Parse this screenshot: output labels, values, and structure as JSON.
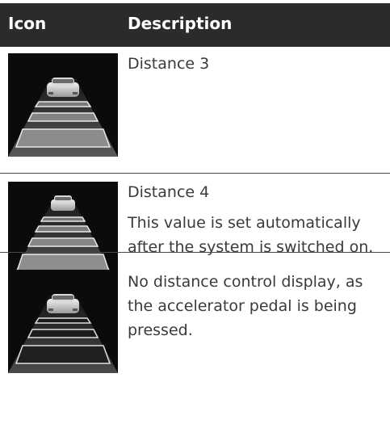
{
  "table": {
    "header": {
      "icon": "Icon",
      "description": "Description"
    },
    "rows": [
      {
        "icon": "distance-3-car-icon",
        "lines": [
          "Distance 3"
        ]
      },
      {
        "icon": "distance-4-car-icon",
        "lines": [
          "Distance 4",
          "This value is set automatically after the system is switched on."
        ]
      },
      {
        "icon": "no-distance-control-icon",
        "lines": [
          "No distance control display, as the accelerator pedal is being pressed."
        ]
      }
    ]
  }
}
